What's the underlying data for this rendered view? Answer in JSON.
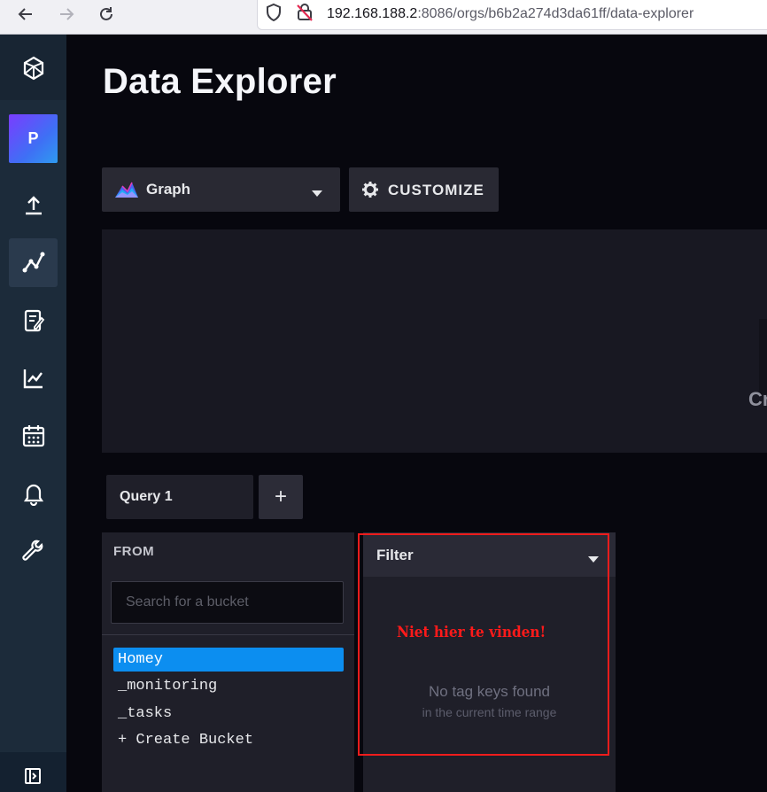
{
  "browser": {
    "url_host": "192.168.188.2",
    "url_path": ":8086/orgs/b6b2a274d3da61ff/data-explorer",
    "icons": [
      "back-arrow-icon",
      "forward-arrow-icon",
      "reload-icon",
      "shield-icon",
      "insecure-lock-icon"
    ]
  },
  "sidebar": {
    "avatar_letter": "P",
    "items": [
      {
        "name": "logo-icon"
      },
      {
        "name": "upload-icon"
      },
      {
        "name": "data-explorer-icon",
        "active": true
      },
      {
        "name": "notebook-icon"
      },
      {
        "name": "dashboard-icon"
      },
      {
        "name": "tasks-calendar-icon"
      },
      {
        "name": "alerts-bell-icon"
      },
      {
        "name": "settings-wrench-icon"
      }
    ]
  },
  "page": {
    "title": "Data Explorer"
  },
  "toolbar": {
    "graph_type_label": "Graph",
    "customize_label": "CUSTOMIZE"
  },
  "graph": {
    "cutoff_text": "Cr"
  },
  "query": {
    "tab_label": "Query 1",
    "add_label": "+"
  },
  "from": {
    "header": "FROM",
    "search_placeholder": "Search for a bucket",
    "buckets": [
      "Homey",
      "_monitoring",
      "_tasks",
      "+ Create Bucket"
    ],
    "selected": "Homey"
  },
  "filter": {
    "header": "Filter",
    "empty_title": "No tag keys found",
    "empty_sub": "in the current time range"
  },
  "annotation": {
    "text": "Niet hier te vinden!",
    "color": "#ee1c1c"
  },
  "colors": {
    "accent": "#0c8ef0",
    "background": "#07070e",
    "sidebar": "#1c2b3a"
  }
}
